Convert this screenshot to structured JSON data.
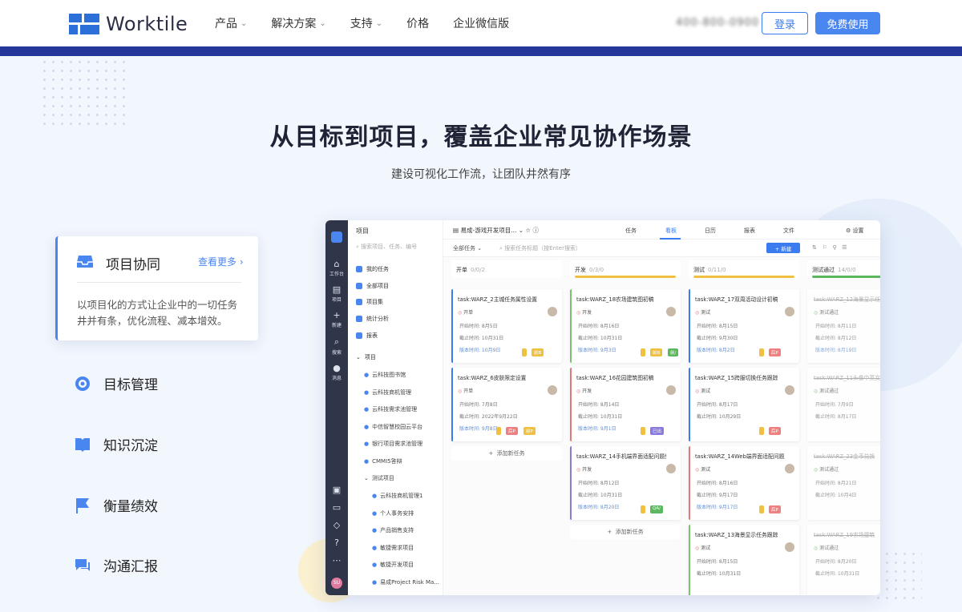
{
  "brand": {
    "name": "Worktile",
    "color": "#2d6fd8"
  },
  "nav": {
    "items": [
      {
        "label": "产品",
        "dropdown": true
      },
      {
        "label": "解决方案",
        "dropdown": true
      },
      {
        "label": "支持",
        "dropdown": true
      },
      {
        "label": "价格",
        "dropdown": false
      },
      {
        "label": "企业微信版",
        "dropdown": false
      }
    ],
    "phone": "400-800-0900",
    "login": "登录",
    "free": "免费使用"
  },
  "hero": {
    "title": "从目标到项目，覆盖企业常见协作场景",
    "subtitle": "建设可视化工作流，让团队井然有序"
  },
  "features": {
    "active": {
      "title": "项目协同",
      "more": "查看更多",
      "desc": "以项目化的方式让企业中的一切任务井并有条，优化流程、减本增效。"
    },
    "items": [
      {
        "title": "目标管理",
        "icon": "target-icon"
      },
      {
        "title": "知识沉淀",
        "icon": "book-icon"
      },
      {
        "title": "衡量绩效",
        "icon": "flag-icon"
      },
      {
        "title": "沟通汇报",
        "icon": "chat-icon"
      }
    ]
  },
  "app": {
    "rail": [
      "工作台",
      "项目",
      "新建",
      "搜索",
      "消息"
    ],
    "user_initials": "SU",
    "side": {
      "title": "项目",
      "search": "搜索项目、任务、编号",
      "items": [
        "我的任务",
        "全部项目",
        "项目集",
        "统计分析",
        "报表"
      ],
      "group": "项目",
      "projects": [
        "云科技图书馆",
        "云科技商机管理",
        "云科技需求池管理",
        "中信智慧校园云平台",
        "银行项目需求池管理",
        "CMMI5答辩"
      ],
      "subgroup": "测试项目",
      "subprojects": [
        "云科技商机管理1",
        "个人事务安排",
        "产品销售支持",
        "敏捷需求项目",
        "敏捷开发项目",
        "易成Project Risk Ma..."
      ]
    },
    "toolbar": {
      "project": "易成-游戏开发项目...",
      "tabs": [
        "任务",
        "看板",
        "日历",
        "报表",
        "文件"
      ],
      "settings": "设置"
    },
    "filter": {
      "all": "全部任务",
      "search": "搜索任务标题（按Enter搜索）",
      "new": "+ 新建"
    },
    "columns": [
      {
        "name": "开单",
        "count": "0/0/2",
        "bar": "#ffffff",
        "cards": [
          {
            "title": "task:WARZ_2主城任务属性设置",
            "status": "开单",
            "start": "开始时间: 8月5日",
            "due": "截止时间: 10月31日",
            "ver": "版本时间: 10月9日",
            "tags": [
              {
                "t": "",
                "c": "#f0c040"
              },
              {
                "t": "前B",
                "c": "#f0c040"
              }
            ],
            "accent": "#3a7bf0"
          },
          {
            "title": "task:WARZ_6皮肤限定设置",
            "status": "开单",
            "start": "开始时间: 7月8日",
            "due": "截止时间: 2022年9月22日",
            "ver": "版本时间: 9月8日",
            "tags": [
              {
                "t": "",
                "c": "#f0c040"
              },
              {
                "t": "后P",
                "c": "#f08080"
              },
              {
                "t": "前P",
                "c": "#f0c040"
              }
            ],
            "accent": "#3a7bf0"
          }
        ],
        "add": "添加新任务"
      },
      {
        "name": "开发",
        "count": "0/3/0",
        "bar": "#f0c040",
        "cards": [
          {
            "title": "task:WARZ_18农场建筑图初稿",
            "status": "开发",
            "start": "开始时间: 8月16日",
            "due": "截止时间: 10月31日",
            "ver": "版本时间: 9月3日",
            "tags": [
              {
                "t": "",
                "c": "#f0c040"
              },
              {
                "t": "前B",
                "c": "#f0c040"
              },
              {
                "t": "前/",
                "c": "#5cb85c"
              }
            ],
            "accent": "#7ac56b"
          },
          {
            "title": "task:WARZ_16花园建筑图初稿",
            "status": "开发",
            "start": "开始时间: 8月14日",
            "due": "截止时间: 10月31日",
            "ver": "版本时间: 9月1日",
            "tags": [
              {
                "t": "",
                "c": "#f0c040"
              },
              {
                "t": "已出",
                "c": "#8a7ae0"
              }
            ],
            "accent": "#e07a7a"
          },
          {
            "title": "task:WARZ_14手机端界面适配问题处理",
            "status": "开发",
            "start": "开始时间: 8月12日",
            "due": "截止时间: 10月31日",
            "ver": "版本时间: 8月20日",
            "tags": [
              {
                "t": "",
                "c": "#f0c040"
              },
              {
                "t": "QA/",
                "c": "#5cb85c"
              }
            ],
            "accent": "#8a7ae0"
          }
        ],
        "add": "添加新任务"
      },
      {
        "name": "测试",
        "count": "0/11/0",
        "bar": "#f0c040",
        "cards": [
          {
            "title": "task:WARZ_17双周活动设计初稿",
            "status": "测试",
            "start": "开始时间: 8月15日",
            "due": "截止时间: 9月30日",
            "ver": "版本时间: 8月2日",
            "tags": [
              {
                "t": "",
                "c": "#f0c040"
              },
              {
                "t": "后P",
                "c": "#f08080"
              }
            ],
            "accent": "#3a7bf0"
          },
          {
            "title": "task:WARZ_15跨服切换任务跟踪",
            "status": "测试",
            "start": "开始时间: 8月17日",
            "due": "截止时间: 10月29日",
            "ver": "",
            "tags": [
              {
                "t": "",
                "c": "#f0c040"
              },
              {
                "t": "后P",
                "c": "#f08080"
              }
            ],
            "accent": "#3a7bf0"
          },
          {
            "title": "task:WARZ_14Web端界面适配问题处理",
            "status": "测试",
            "start": "开始时间: 8月16日",
            "due": "截止时间: 9月17日",
            "ver": "版本时间: 9月17日",
            "tags": [
              {
                "t": "",
                "c": "#f0c040"
              },
              {
                "t": "后P",
                "c": "#f08080"
              }
            ],
            "accent": "#e07a7a"
          },
          {
            "title": "task:WARZ_13海景显示任务跟踪",
            "status": "测试",
            "start": "开始时间: 8月15日",
            "due": "截止时间: 10月31日",
            "ver": "",
            "tags": [],
            "accent": "#7ac56b"
          }
        ],
        "add": "添加新任务"
      },
      {
        "name": "测试通过",
        "count": "14/0/0",
        "bar": "#5cb85c",
        "cards": [
          {
            "title": "task:WARZ_12海景显示任务",
            "status": "测试通过",
            "start": "开始时间: 8月11日",
            "due": "截止时间: 8月12日",
            "ver": "版本时间: 8月19日",
            "tags": [],
            "accent": "#ffffff"
          },
          {
            "title": "task:WARZ_11头像中英文",
            "status": "测试通过",
            "start": "开始时间: 7月9日",
            "due": "截止时间: 8月17日",
            "ver": "",
            "tags": [],
            "accent": "#ffffff"
          },
          {
            "title": "task:WARZ_23金币兑换",
            "status": "测试通过",
            "start": "开始时间: 8月21日",
            "due": "截止时间: 10月4日",
            "ver": "",
            "tags": [],
            "accent": "#ffffff"
          },
          {
            "title": "task:WARZ_19农场建筑",
            "status": "测试通过",
            "start": "开始时间: 8月20日",
            "due": "截止时间: 10月31日",
            "ver": "",
            "tags": [],
            "accent": "#ffffff"
          }
        ],
        "add": "添加新任务"
      }
    ]
  }
}
